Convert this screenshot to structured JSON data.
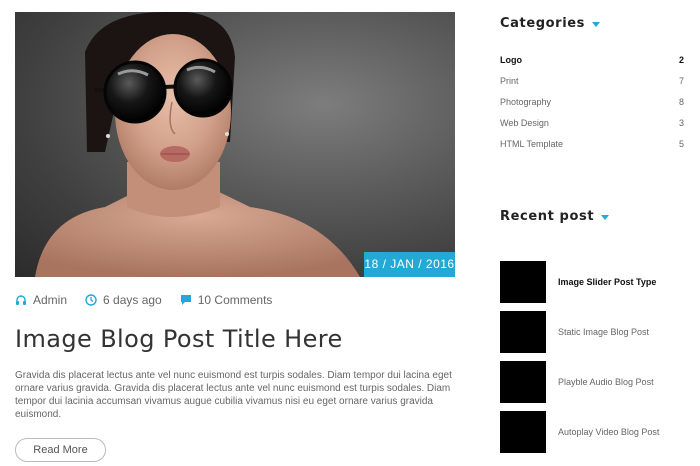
{
  "post": {
    "image_alt": "Woman with large round sunglasses",
    "date": "18 / JAN / 2016",
    "meta": {
      "author": "Admin",
      "time": "6 days ago",
      "comments": "10 Comments"
    },
    "title": "Image Blog Post Title Here",
    "excerpt": "Gravida dis placerat lectus ante vel nunc euismond est turpis sodales. Diam tempor dui lacina eget ornare varius gravida. Gravida dis placerat lectus ante vel nunc euismond est turpis sodales. Diam tempor dui lacinia accumsan vivamus augue cubilia vivamus nisi eu eget ornare varius gravida euismond.",
    "read_more": "Read More"
  },
  "sidebar": {
    "categories_title": "Categories",
    "categories": [
      {
        "label": "Logo",
        "count": "2"
      },
      {
        "label": "Print",
        "count": "7"
      },
      {
        "label": "Photography",
        "count": "8"
      },
      {
        "label": "Web Design",
        "count": "3"
      },
      {
        "label": "HTML Template",
        "count": "5"
      }
    ],
    "recent_title": "Recent post",
    "recent": [
      {
        "title": "Image Slider Post Type"
      },
      {
        "title": "Static Image Blog Post"
      },
      {
        "title": "Playble Audio Blog Post"
      },
      {
        "title": "Autoplay Video Blog Post"
      }
    ]
  },
  "colors": {
    "accent": "#22a9d6",
    "heading": "#222222",
    "text": "#666666"
  },
  "icons": {
    "author": "headphones-icon",
    "time": "clock-icon",
    "comments": "comment-icon",
    "caret": "caret-down-icon"
  }
}
